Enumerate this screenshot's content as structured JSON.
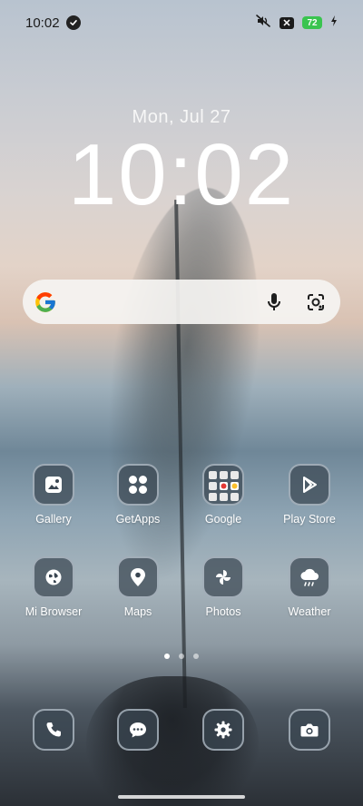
{
  "status_bar": {
    "time": "10:02",
    "battery": "72",
    "icons": [
      "verified-icon",
      "silent-icon",
      "close-icon",
      "battery-icon",
      "charging-icon"
    ]
  },
  "lock_info": {
    "date": "Mon, Jul 27",
    "time": "10:02"
  },
  "search_bar": {
    "icons": [
      "google-logo-icon",
      "microphone-icon",
      "lens-icon"
    ]
  },
  "apps_row1": [
    {
      "label": "Gallery",
      "icon": "gallery-icon"
    },
    {
      "label": "GetApps",
      "icon": "getapps-icon"
    },
    {
      "label": "Google",
      "icon": "google-folder-icon"
    },
    {
      "label": "Play Store",
      "icon": "play-store-icon"
    }
  ],
  "apps_row2": [
    {
      "label": "Mi Browser",
      "icon": "globe-icon"
    },
    {
      "label": "Maps",
      "icon": "map-pin-icon"
    },
    {
      "label": "Photos",
      "icon": "pinwheel-icon"
    },
    {
      "label": "Weather",
      "icon": "cloud-rain-icon"
    }
  ],
  "dock": [
    {
      "icon": "phone-icon"
    },
    {
      "icon": "chat-icon"
    },
    {
      "icon": "settings-icon"
    },
    {
      "icon": "camera-icon"
    }
  ],
  "page_indicator": {
    "count": 3,
    "active": 1
  },
  "colors": {
    "battery_green": "#39c44f",
    "tile_bg": "#3a4652",
    "search_bg": "#f5f4f2"
  }
}
